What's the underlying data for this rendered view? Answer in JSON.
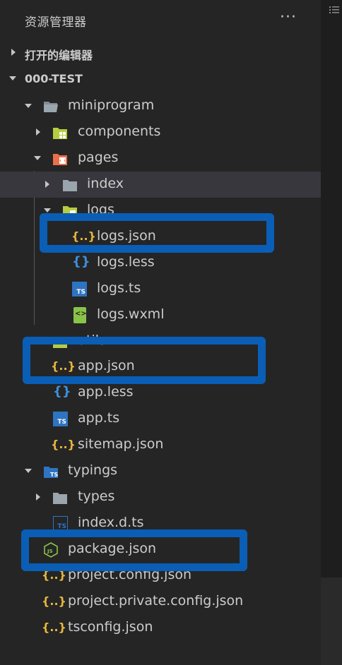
{
  "header": {
    "title": "资源管理器",
    "more": "···"
  },
  "sections": {
    "open_editors": "打开的编辑器",
    "workspace": "000-TEST"
  },
  "tree": {
    "miniprogram": "miniprogram",
    "components": "components",
    "pages": "pages",
    "index": "index",
    "logs": "logs",
    "logs_json": "logs.json",
    "logs_less": "logs.less",
    "logs_ts": "logs.ts",
    "logs_wxml": "logs.wxml",
    "utils": "utils",
    "app_json": "app.json",
    "app_less": "app.less",
    "app_ts": "app.ts",
    "sitemap_json": "sitemap.json",
    "typings": "typings",
    "types": "types",
    "index_d_ts": "index.d.ts",
    "package_json": "package.json",
    "project_config_json": "project.config.json",
    "project_private_config_json": "project.private.config.json",
    "tsconfig_json": "tsconfig.json"
  },
  "icon_glyphs": {
    "json": "{..}",
    "less": "{}",
    "ts": "TS",
    "wxml": "<>",
    "node": "JS"
  },
  "colors": {
    "highlight_box": "#0a5eb5",
    "json_icon": "#e8b73d",
    "less_icon": "#3c8fd8",
    "ts_icon": "#2f74c0",
    "wxml_icon": "#8bc34a",
    "selected_row": "#37373d"
  }
}
